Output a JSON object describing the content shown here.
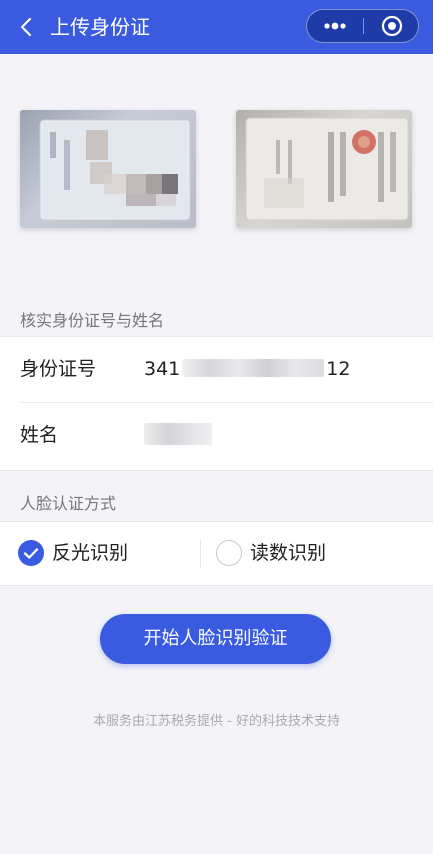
{
  "nav": {
    "title": "上传身份证",
    "back_icon": "chevron-left-icon",
    "more_icon": "more-dots-icon",
    "close_icon": "target-close-icon",
    "bar_color": "#3a5ae0"
  },
  "id_cards": {
    "front_icon": "id-card-front-photo",
    "back_icon": "id-card-back-photo"
  },
  "verify": {
    "section_label": "核实身份证号与姓名",
    "id_label": "身份证号",
    "id_prefix": "341",
    "id_suffix": "12",
    "name_label": "姓名"
  },
  "face": {
    "section_label": "人脸认证方式",
    "options": [
      {
        "label": "反光识别",
        "checked": true
      },
      {
        "label": "读数识别",
        "checked": false
      }
    ]
  },
  "start_button": "开始人脸识别验证",
  "footer": "本服务由江苏税务提供 - 好的科技技术支持",
  "colors": {
    "accent": "#3a5ae0",
    "page_bg": "#f4f4f8"
  }
}
